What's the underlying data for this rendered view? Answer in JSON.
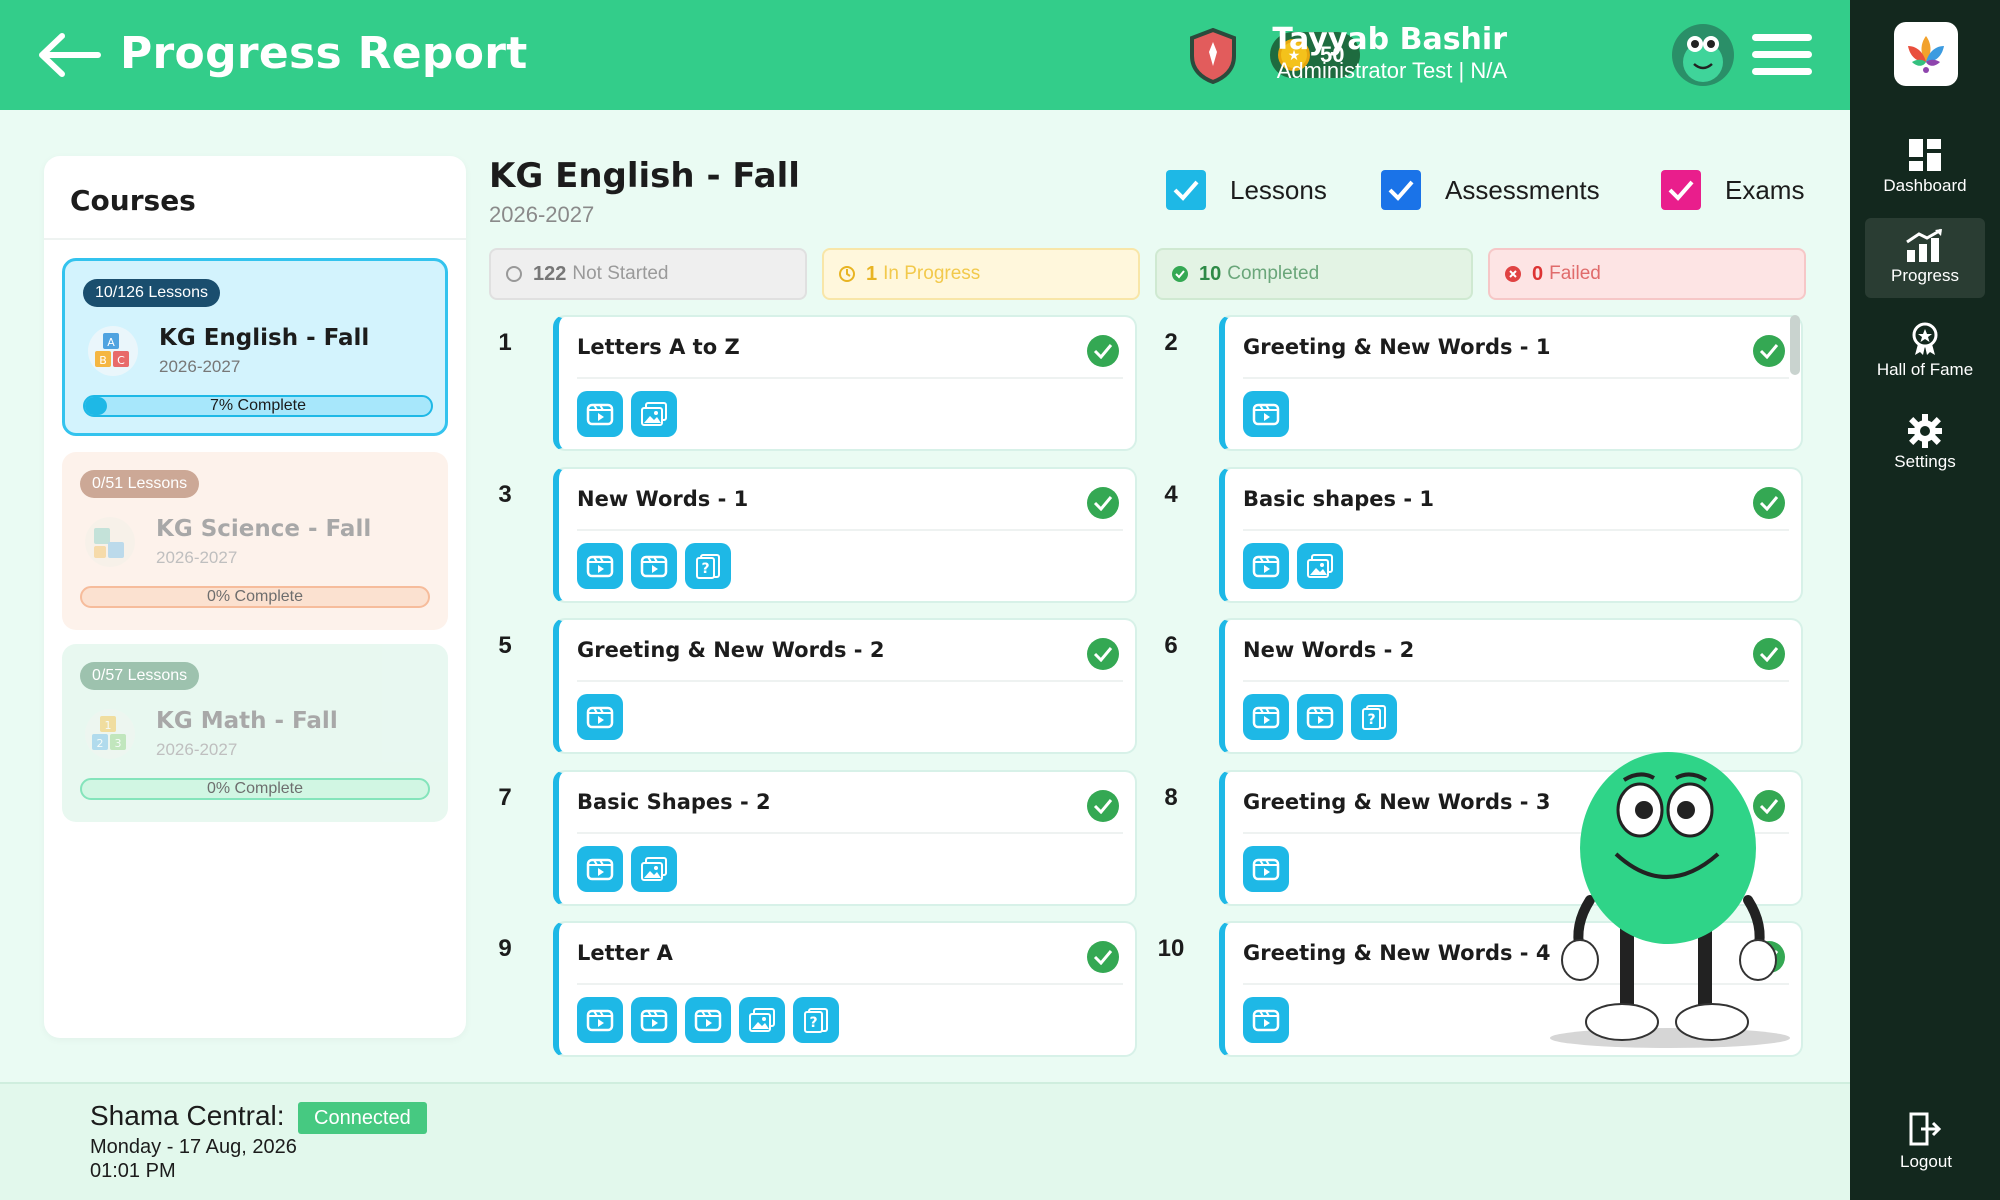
{
  "header": {
    "title": "Progress Report",
    "coins": "50",
    "user_name": "Tayyab Bashir",
    "user_role": "Administrator Test | N/A"
  },
  "sidebar": {
    "items": [
      {
        "label": "Dashboard",
        "icon": "dashboard-icon",
        "active": false
      },
      {
        "label": "Progress",
        "icon": "progress-chart-icon",
        "active": true
      },
      {
        "label": "Hall of Fame",
        "icon": "award-icon",
        "active": false
      },
      {
        "label": "Settings",
        "icon": "gear-icon",
        "active": false
      }
    ],
    "logout": "Logout"
  },
  "courses": {
    "title": "Courses",
    "items": [
      {
        "badge": "10/126 Lessons",
        "name": "KG English - Fall",
        "year": "2026-2027",
        "progress": "7% Complete",
        "percent": 7,
        "active": true
      },
      {
        "badge": "0/51 Lessons",
        "name": "KG Science - Fall",
        "year": "2026-2027",
        "progress": "0% Complete",
        "percent": 0,
        "active": false
      },
      {
        "badge": "0/57 Lessons",
        "name": "KG Math - Fall",
        "year": "2026-2027",
        "progress": "0% Complete",
        "percent": 0,
        "active": false
      }
    ]
  },
  "main": {
    "title": "KG English - Fall",
    "year": "2026-2027",
    "filters": [
      {
        "label": "Lessons",
        "checked": true,
        "color": "#1eb8e6"
      },
      {
        "label": "Assessments",
        "checked": true,
        "color": "#1a73e8"
      },
      {
        "label": "Exams",
        "checked": true,
        "color": "#e91e8c"
      }
    ],
    "status": [
      {
        "count": "122",
        "label": "Not Started"
      },
      {
        "count": "1",
        "label": "In Progress"
      },
      {
        "count": "10",
        "label": "Completed"
      },
      {
        "count": "0",
        "label": "Failed"
      }
    ],
    "lessons": [
      {
        "num": "1",
        "title": "Letters A to Z",
        "icons": [
          "video-icon",
          "image-icon"
        ]
      },
      {
        "num": "2",
        "title": "Greeting & New Words - 1",
        "icons": [
          "video-icon"
        ]
      },
      {
        "num": "3",
        "title": "New Words - 1",
        "icons": [
          "video-icon",
          "video-icon",
          "quiz-icon"
        ]
      },
      {
        "num": "4",
        "title": "Basic shapes - 1",
        "icons": [
          "video-icon",
          "image-icon"
        ]
      },
      {
        "num": "5",
        "title": "Greeting & New Words - 2",
        "icons": [
          "video-icon"
        ]
      },
      {
        "num": "6",
        "title": "New Words - 2",
        "icons": [
          "video-icon",
          "video-icon",
          "quiz-icon"
        ]
      },
      {
        "num": "7",
        "title": "Basic Shapes - 2",
        "icons": [
          "video-icon",
          "image-icon"
        ]
      },
      {
        "num": "8",
        "title": "Greeting & New Words - 3",
        "icons": [
          "video-icon"
        ]
      },
      {
        "num": "9",
        "title": "Letter A",
        "icons": [
          "video-icon",
          "video-icon",
          "video-icon",
          "image-icon",
          "quiz-icon"
        ]
      },
      {
        "num": "10",
        "title": "Greeting & New Words - 4",
        "icons": [
          "video-icon"
        ]
      }
    ]
  },
  "footer": {
    "name": "Shama Central:",
    "status": "Connected",
    "date": "Monday - 17 Aug, 2026",
    "time": "01:01 PM"
  },
  "colors": {
    "header": "#33cd8a",
    "sidebar": "#13281e",
    "accent": "#1eb8e6",
    "complete": "#34a853"
  }
}
